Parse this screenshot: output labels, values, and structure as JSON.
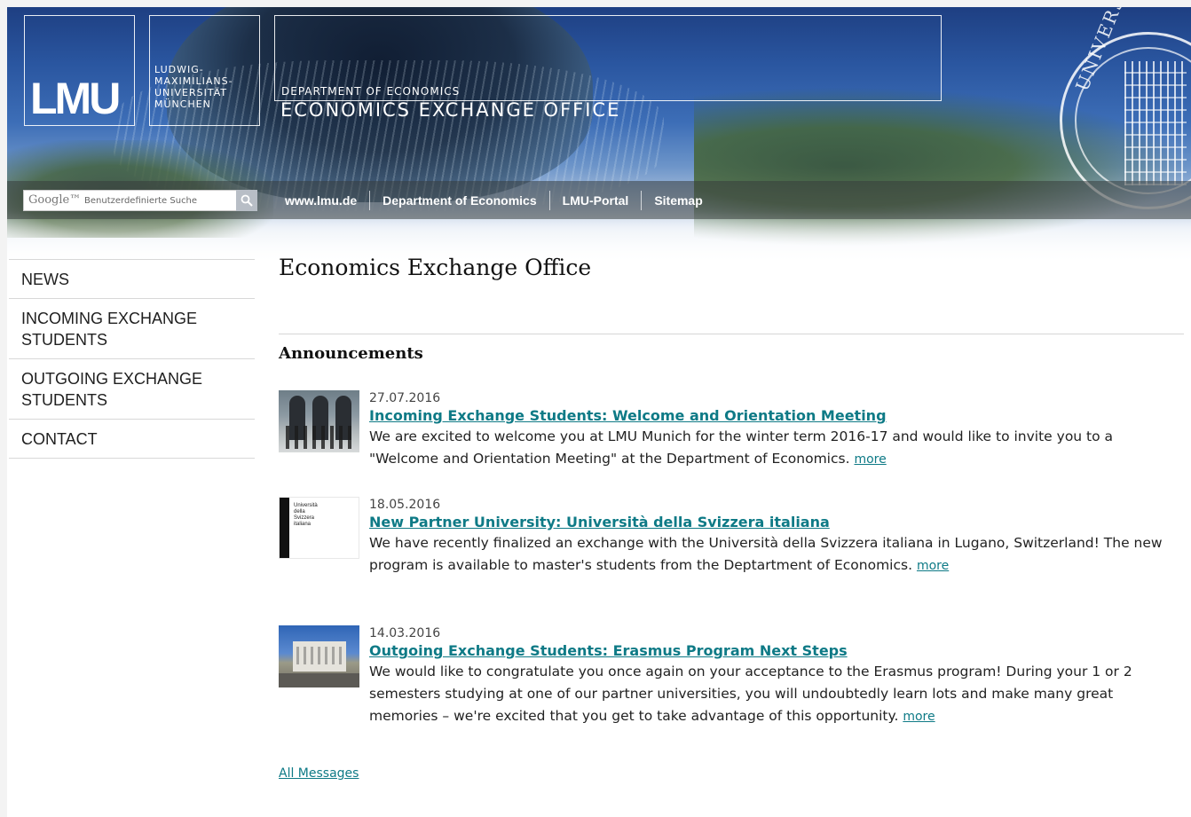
{
  "header": {
    "logo_text": "LMU",
    "university_lines": [
      "LUDWIG-",
      "MAXIMILIANS-",
      "UNIVERSITÄT",
      "MÜNCHEN"
    ],
    "department": "DEPARTMENT OF ECONOMICS",
    "office": "ECONOMICS EXCHANGE OFFICE",
    "seal_text": "UNIVERSI"
  },
  "search": {
    "brand": "Google™",
    "placeholder": "Benutzerdefinierte Suche"
  },
  "nav": {
    "links": [
      "www.lmu.de",
      "Department of Economics",
      "LMU-Portal",
      "Sitemap"
    ]
  },
  "sidebar": {
    "items": [
      {
        "label": "NEWS"
      },
      {
        "label": "INCOMING EXCHANGE STUDENTS"
      },
      {
        "label": "OUTGOING EXCHANGE STUDENTS"
      },
      {
        "label": "CONTACT"
      }
    ]
  },
  "main": {
    "title": "Economics Exchange Office",
    "section": "Announcements",
    "news": [
      {
        "date": "27.07.2016",
        "title": "Incoming Exchange Students: Welcome and Orientation Meeting",
        "text": "We are excited to welcome you at LMU Munich for the winter term 2016-17 and would like to invite you to a \"Welcome and Orientation Meeting\" at the Department of Economics.",
        "more": "more"
      },
      {
        "date": "18.05.2016",
        "title": "New Partner University: Università della Svizzera italiana",
        "text": "We have recently finalized an exchange with the Università della Svizzera italiana in Lugano, Switzerland! The new program is available to master's students from the Deptartment of Economics.",
        "more": "more",
        "thumb_lines": [
          "Università",
          "della",
          "Svizzera",
          "italiana"
        ]
      },
      {
        "date": "14.03.2016",
        "title": "Outgoing Exchange Students: Erasmus Program Next Steps",
        "text": "We would like to congratulate you once again on your acceptance to the Erasmus program! During your 1 or 2 semesters studying at one of our partner universities, you will undoubtedly learn lots and make many great memories – we're excited that you get to take advantage of this opportunity.",
        "more": "more"
      }
    ],
    "all_messages": "All Messages"
  }
}
